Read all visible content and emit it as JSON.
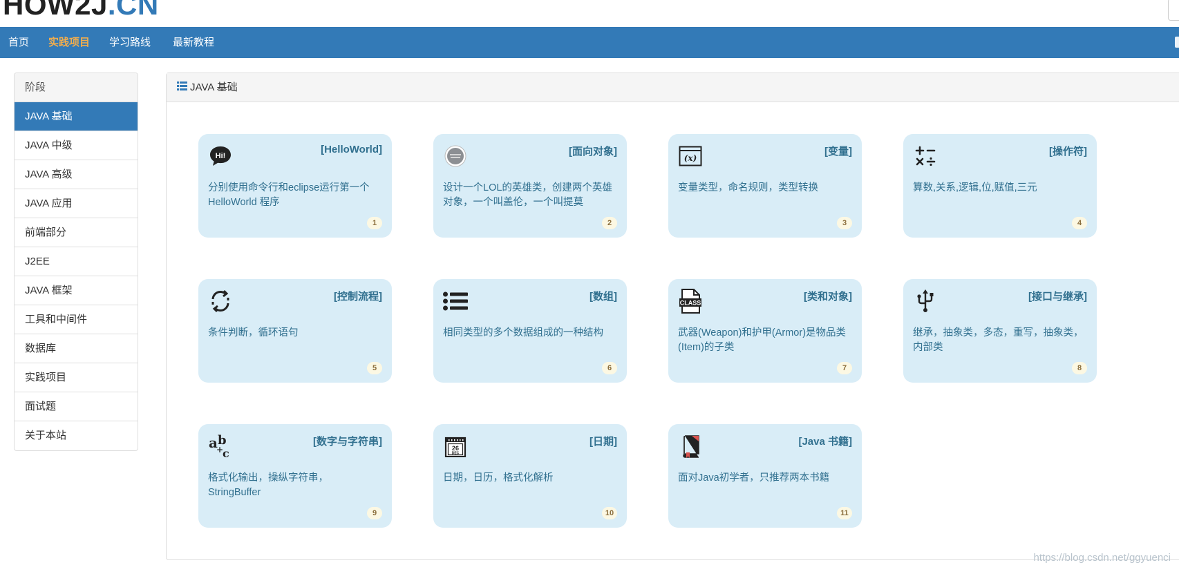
{
  "header": {
    "logo_main": "HOW2J",
    "logo_accent": ".CN"
  },
  "nav": {
    "items": [
      {
        "label": "首页",
        "active": false
      },
      {
        "label": "实践项目",
        "active": true
      },
      {
        "label": "学习路线",
        "active": false
      },
      {
        "label": "最新教程",
        "active": false
      }
    ]
  },
  "sidebar": {
    "heading": "阶段",
    "items": [
      {
        "label": "JAVA 基础",
        "active": true
      },
      {
        "label": "JAVA 中级",
        "active": false
      },
      {
        "label": "JAVA 高级",
        "active": false
      },
      {
        "label": "JAVA 应用",
        "active": false
      },
      {
        "label": "前端部分",
        "active": false
      },
      {
        "label": "J2EE",
        "active": false
      },
      {
        "label": "JAVA 框架",
        "active": false
      },
      {
        "label": "工具和中间件",
        "active": false
      },
      {
        "label": "数据库",
        "active": false
      },
      {
        "label": "实践项目",
        "active": false
      },
      {
        "label": "面试题",
        "active": false
      },
      {
        "label": "关于本站",
        "active": false
      }
    ]
  },
  "panel": {
    "title": "JAVA 基础"
  },
  "cards": [
    {
      "title": "[HelloWorld]",
      "desc": "分别使用命令行和eclipse运行第一个HelloWorld 程序",
      "num": "1",
      "icon": "hi-bubble-icon"
    },
    {
      "title": "[面向对象]",
      "desc": "设计一个LOL的英雄类，创建两个英雄对象，一个叫盖伦，一个叫提莫",
      "num": "2",
      "icon": "lol-logo-icon"
    },
    {
      "title": "[变量]",
      "desc": "变量类型，命名规则，类型转换",
      "num": "3",
      "icon": "variable-icon"
    },
    {
      "title": "[操作符]",
      "desc": "算数,关系,逻辑,位,赋值,三元",
      "num": "4",
      "icon": "operators-icon"
    },
    {
      "title": "[控制流程]",
      "desc": "条件判断，循环语句",
      "num": "5",
      "icon": "loop-arrows-icon"
    },
    {
      "title": "[数组]",
      "desc": "相同类型的多个数据组成的一种结构",
      "num": "6",
      "icon": "list-icon"
    },
    {
      "title": "[类和对象]",
      "desc": "武器(Weapon)和护甲(Armor)是物品类(Item)的子类",
      "num": "7",
      "icon": "class-file-icon"
    },
    {
      "title": "[接口与继承]",
      "desc": "继承，抽象类，多态，重写，抽象类，内部类",
      "num": "8",
      "icon": "usb-icon"
    },
    {
      "title": "[数字与字符串]",
      "desc": "格式化输出，操纵字符串，StringBuffer",
      "num": "9",
      "icon": "abc-icon"
    },
    {
      "title": "[日期]",
      "desc": "日期，日历，格式化解析",
      "num": "10",
      "icon": "calendar-icon"
    },
    {
      "title": "[Java 书籍]",
      "desc": "面对Java初学者，只推荐两本书籍",
      "num": "11",
      "icon": "book-icon"
    }
  ],
  "watermark": "https://blog.csdn.net/ggyuenci"
}
